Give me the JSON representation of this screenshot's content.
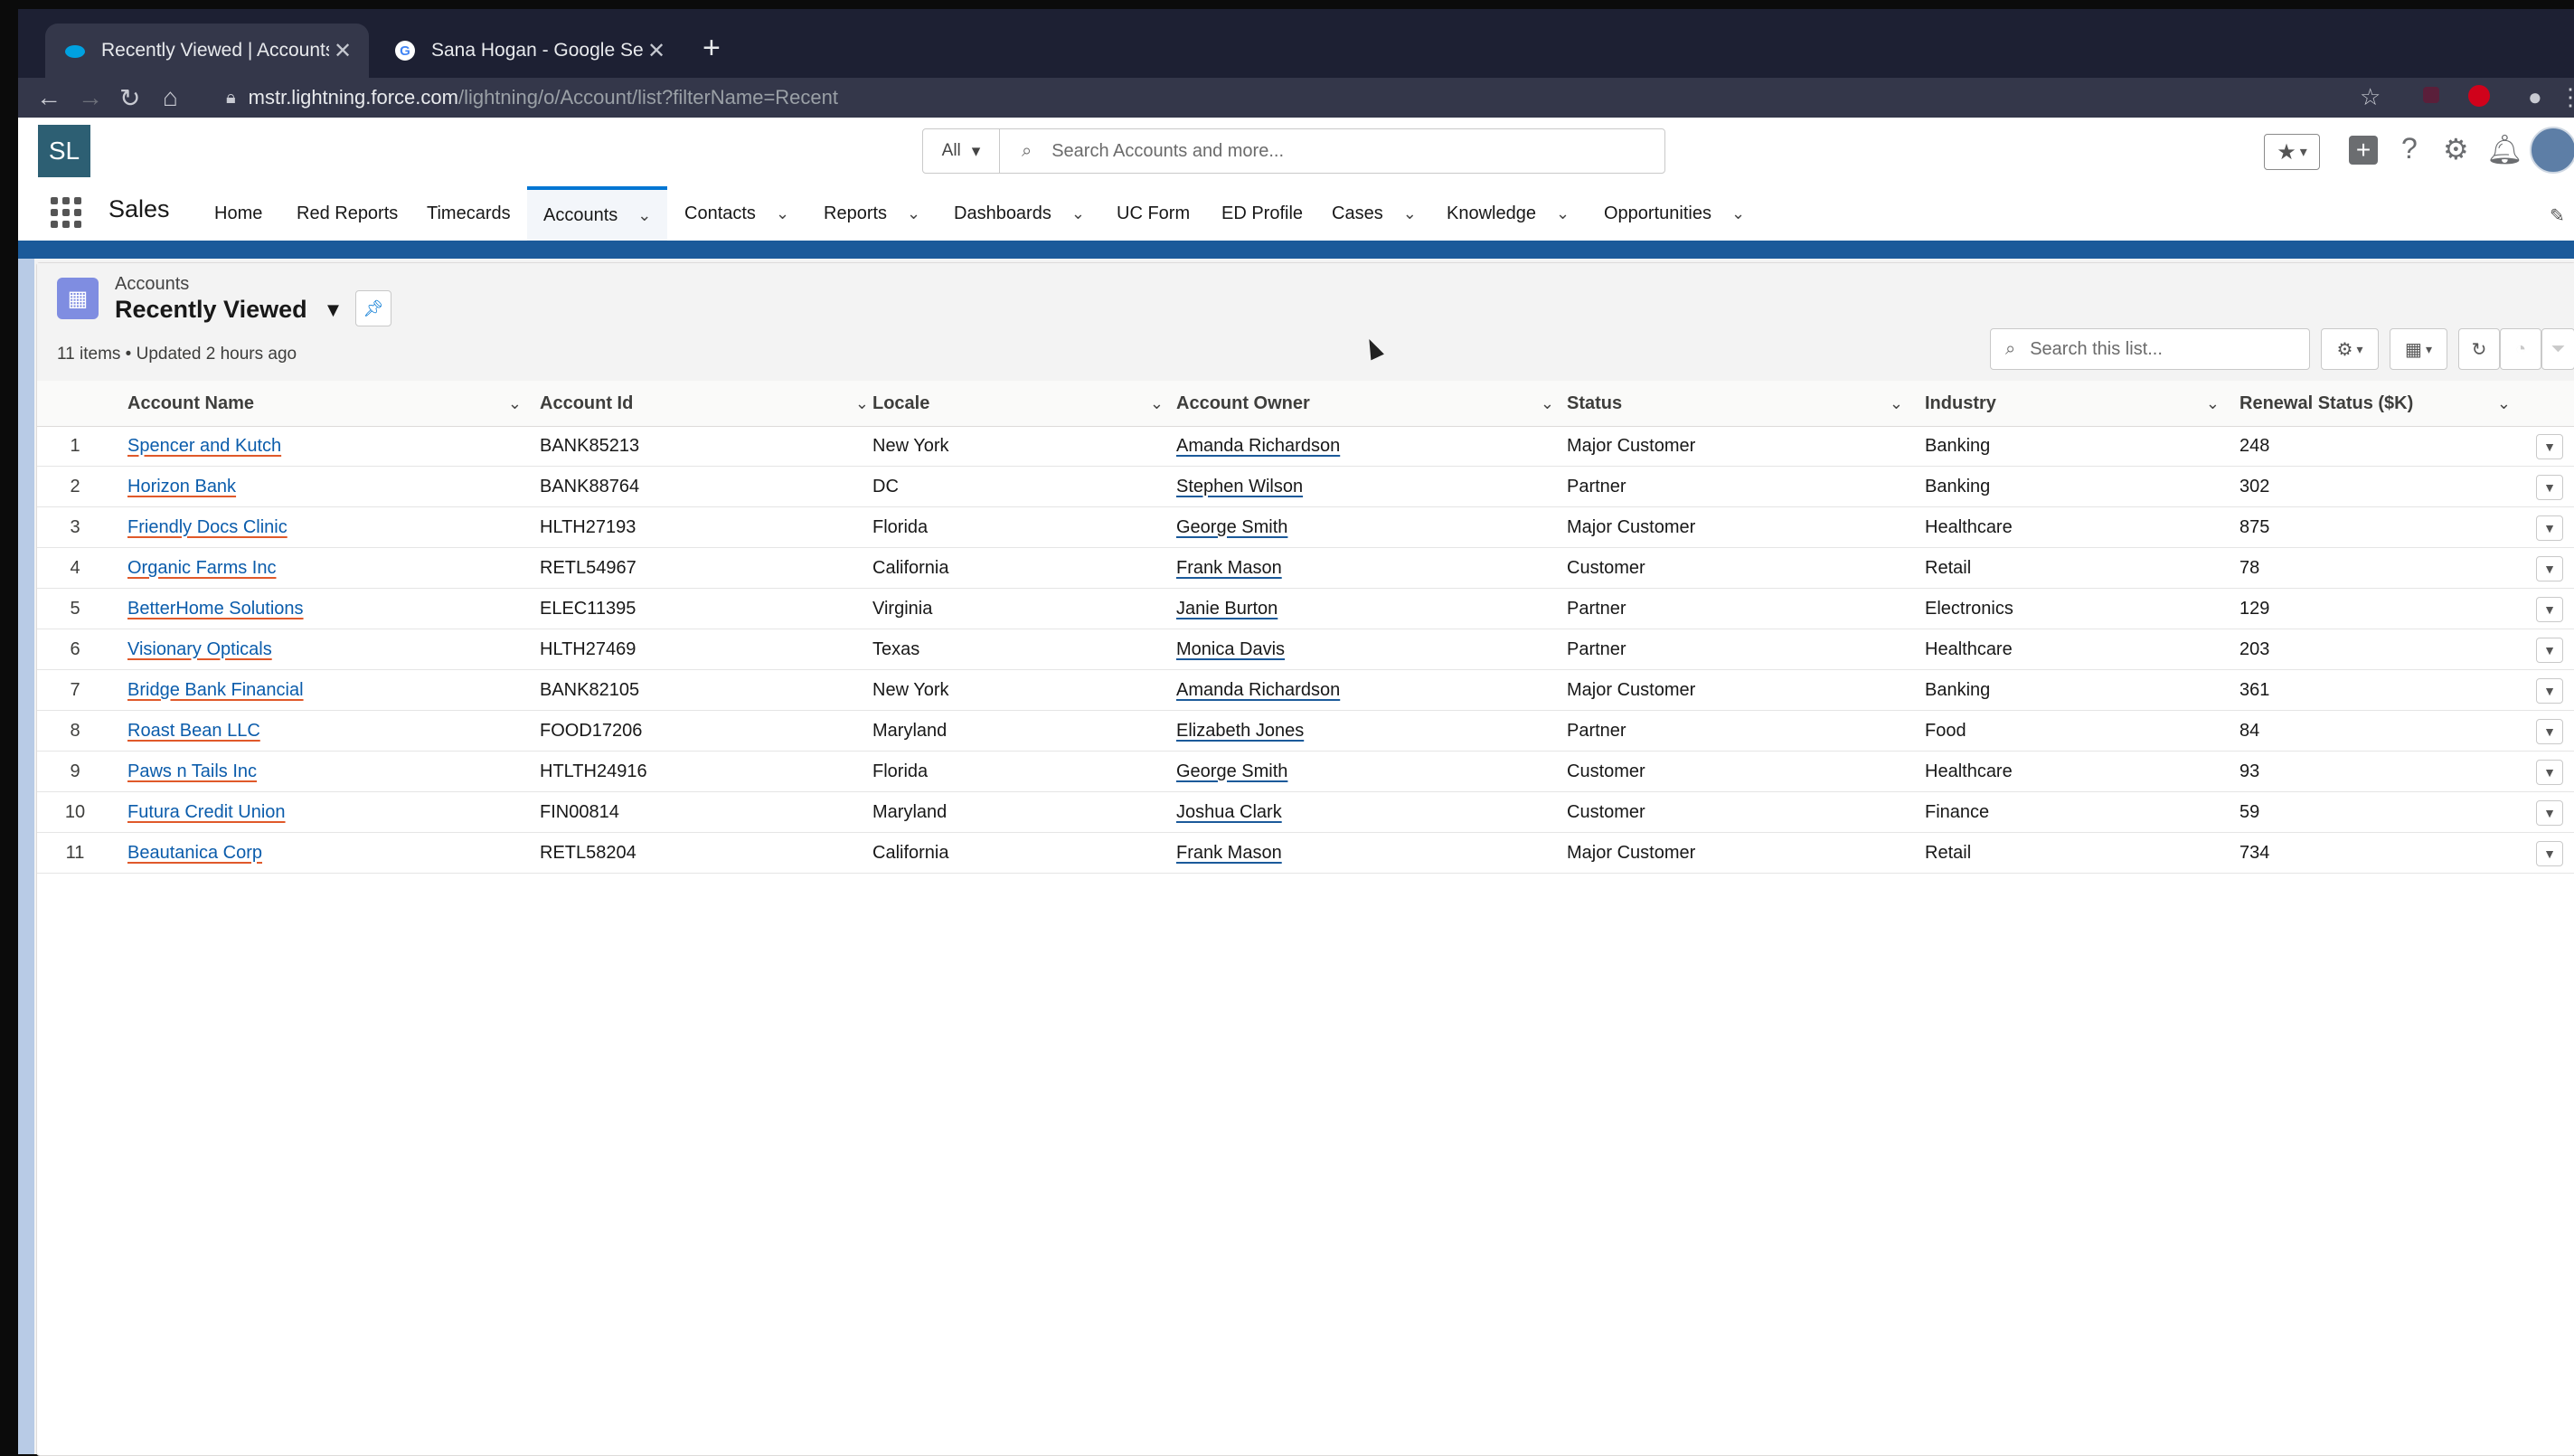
{
  "browser": {
    "tabs": [
      {
        "title": "Recently Viewed | Accounts | S",
        "active": true,
        "icon": "salesforce-cloud-icon"
      },
      {
        "title": "Sana Hogan - Google Search",
        "active": false,
        "icon": "google-g-icon"
      }
    ],
    "url_host": "mstr.lightning.force.com",
    "url_path": "/lightning/o/Account/list?filterName=Recent"
  },
  "header": {
    "logo_text": "SL",
    "search_scope": "All",
    "search_placeholder": "Search Accounts and more..."
  },
  "nav": {
    "app_name": "Sales",
    "items": [
      {
        "label": "Home",
        "dropdown": false
      },
      {
        "label": "Red Reports",
        "dropdown": false
      },
      {
        "label": "Timecards",
        "dropdown": false
      },
      {
        "label": "Accounts",
        "dropdown": true,
        "active": true
      },
      {
        "label": "Contacts",
        "dropdown": true
      },
      {
        "label": "Reports",
        "dropdown": true
      },
      {
        "label": "Dashboards",
        "dropdown": true
      },
      {
        "label": "UC Form",
        "dropdown": false
      },
      {
        "label": "ED Profile",
        "dropdown": false
      },
      {
        "label": "Cases",
        "dropdown": true
      },
      {
        "label": "Knowledge",
        "dropdown": true
      },
      {
        "label": "Opportunities",
        "dropdown": true
      }
    ]
  },
  "list": {
    "object_label": "Accounts",
    "view_name": "Recently Viewed",
    "meta": "11 items • Updated 2 hours ago",
    "search_placeholder": "Search this list...",
    "columns": [
      "Account Name",
      "Account Id",
      "Locale",
      "Account Owner",
      "Status",
      "Industry",
      "Renewal Status ($K)"
    ],
    "rows": [
      {
        "n": "1",
        "name": "Spencer and Kutch",
        "id": "BANK85213",
        "locale": "New York",
        "owner": "Amanda Richardson",
        "status": "Major Customer",
        "industry": "Banking",
        "renewal": "248"
      },
      {
        "n": "2",
        "name": "Horizon Bank",
        "id": "BANK88764",
        "locale": "DC",
        "owner": "Stephen Wilson",
        "status": "Partner",
        "industry": "Banking",
        "renewal": "302"
      },
      {
        "n": "3",
        "name": "Friendly Docs Clinic",
        "id": "HLTH27193",
        "locale": "Florida",
        "owner": "George Smith",
        "status": "Major Customer",
        "industry": "Healthcare",
        "renewal": "875"
      },
      {
        "n": "4",
        "name": "Organic Farms Inc",
        "id": "RETL54967",
        "locale": "California",
        "owner": "Frank Mason",
        "status": "Customer",
        "industry": "Retail",
        "renewal": "78"
      },
      {
        "n": "5",
        "name": "BetterHome Solutions",
        "id": "ELEC11395",
        "locale": "Virginia",
        "owner": "Janie Burton",
        "status": "Partner",
        "industry": "Electronics",
        "renewal": "129"
      },
      {
        "n": "6",
        "name": "Visionary Opticals",
        "id": "HLTH27469",
        "locale": "Texas",
        "owner": "Monica Davis",
        "status": "Partner",
        "industry": "Healthcare",
        "renewal": "203"
      },
      {
        "n": "7",
        "name": "Bridge Bank Financial",
        "id": "BANK82105",
        "locale": "New York",
        "owner": "Amanda Richardson",
        "status": "Major Customer",
        "industry": "Banking",
        "renewal": "361"
      },
      {
        "n": "8",
        "name": "Roast Bean LLC",
        "id": "FOOD17206",
        "locale": "Maryland",
        "owner": "Elizabeth Jones",
        "status": "Partner",
        "industry": "Food",
        "renewal": "84"
      },
      {
        "n": "9",
        "name": "Paws n Tails Inc",
        "id": "HTLTH24916",
        "locale": "Florida",
        "owner": "George Smith",
        "status": "Customer",
        "industry": "Healthcare",
        "renewal": "93"
      },
      {
        "n": "10",
        "name": "Futura Credit Union",
        "id": "FIN00814",
        "locale": "Maryland",
        "owner": "Joshua Clark",
        "status": "Customer",
        "industry": "Finance",
        "renewal": "59"
      },
      {
        "n": "11",
        "name": "Beautanica Corp",
        "id": "RETL58204",
        "locale": "California",
        "owner": "Frank Mason",
        "status": "Major Customer",
        "industry": "Retail",
        "renewal": "734"
      }
    ]
  },
  "colors": {
    "brand_blue": "#0176d3",
    "link_blue": "#0b5cab",
    "band": "#1b5a9a",
    "object_icon": "#7f8de1"
  }
}
